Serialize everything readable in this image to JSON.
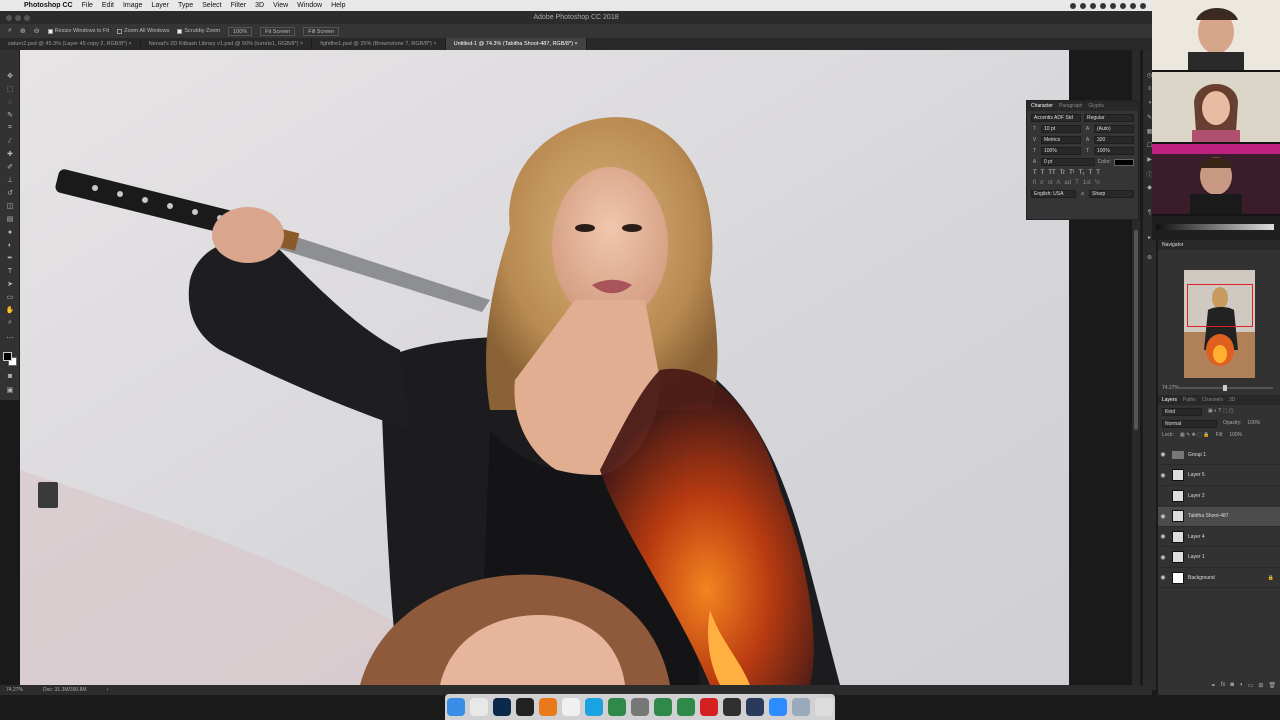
{
  "menubar": {
    "app_name": "Photoshop CC",
    "items": [
      "File",
      "Edit",
      "Image",
      "Layer",
      "Type",
      "Select",
      "Filter",
      "3D",
      "View",
      "Window",
      "Help"
    ]
  },
  "window_title": "Adobe Photoshop CC 2018",
  "options_bar": {
    "resize_windows": "Resize Windows to Fit",
    "zoom_all": "Zoom All Windows",
    "scrubby_zoom": "Scrubby Zoom",
    "zoom_value": "100%",
    "fit_screen": "Fit Screen",
    "fill_screen": "Fill Screen"
  },
  "doc_tabs": [
    "saturn2.psd @ 45.3% (Layer 45 copy 2, RGB/8*) ×",
    "Nenad's 2D Kitbash Library v1.psd @ 50% (turrets1, RGB/8*) ×",
    "fightfire1.psd @ 25% (Brownstone 7, RGB/8*) ×",
    "Untitled-1 @ 74.3% (Tabitha Shoot-487, RGB/8*) ×"
  ],
  "active_tab_index": 3,
  "status_bar": {
    "zoom": "74.27%",
    "doc": "Doc: 31.3M/390.8M"
  },
  "character_panel": {
    "tabs": [
      "Character",
      "Paragraph",
      "Glyphs"
    ],
    "font_family": "Accentis ADF Std",
    "font_style": "Regular",
    "font_size": "10 pt",
    "leading": "(Auto)",
    "kerning": "Metrics",
    "tracking": "320",
    "vscale": "100%",
    "hscale": "100%",
    "baseline": "0 pt",
    "color_label": "Color:",
    "language": "English: USA",
    "antialias": "Sharp",
    "type_buttons": [
      "T",
      "T",
      "TT",
      "Tr",
      "T¹",
      "T₁",
      "T",
      "T"
    ],
    "ot_buttons": [
      "fi",
      "σ",
      "st",
      "A",
      "ad",
      "T",
      "1st",
      "½"
    ]
  },
  "navigator": {
    "title": "Navigator",
    "zoom": "74.27%"
  },
  "layers_panel": {
    "tabs": [
      "Layers",
      "Paths",
      "Channels",
      "3D"
    ],
    "filter_kind": "Kind",
    "blend_mode": "Normal",
    "opacity_label": "Opacity:",
    "opacity": "100%",
    "lock_label": "Lock:",
    "fill_label": "Fill:",
    "fill": "100%",
    "layers": [
      {
        "name": "Group 1",
        "visible": true,
        "selected": false,
        "type": "group"
      },
      {
        "name": "Layer 5",
        "visible": true,
        "selected": false,
        "type": "layer"
      },
      {
        "name": "Layer 2",
        "visible": false,
        "selected": false,
        "type": "layer"
      },
      {
        "name": "Tabitha Shoot-487",
        "visible": true,
        "selected": true,
        "type": "layer"
      },
      {
        "name": "Layer 4",
        "visible": true,
        "selected": false,
        "type": "layer"
      },
      {
        "name": "Layer 1",
        "visible": true,
        "selected": false,
        "type": "layer"
      },
      {
        "name": "Background",
        "visible": true,
        "selected": false,
        "type": "background"
      }
    ]
  },
  "dock_apps": [
    "finder",
    "chrome",
    "photoshop",
    "terminal",
    "blender",
    "itunes",
    "skype",
    "app",
    "sysprefs",
    "app",
    "app",
    "acrobat",
    "s",
    "steam",
    "zoom",
    "preview",
    "trash"
  ],
  "colors": {
    "accent": "#3a8ee6",
    "selection": "#4b4b4b",
    "panel": "#323232",
    "menubar": "#e8e8e8"
  }
}
